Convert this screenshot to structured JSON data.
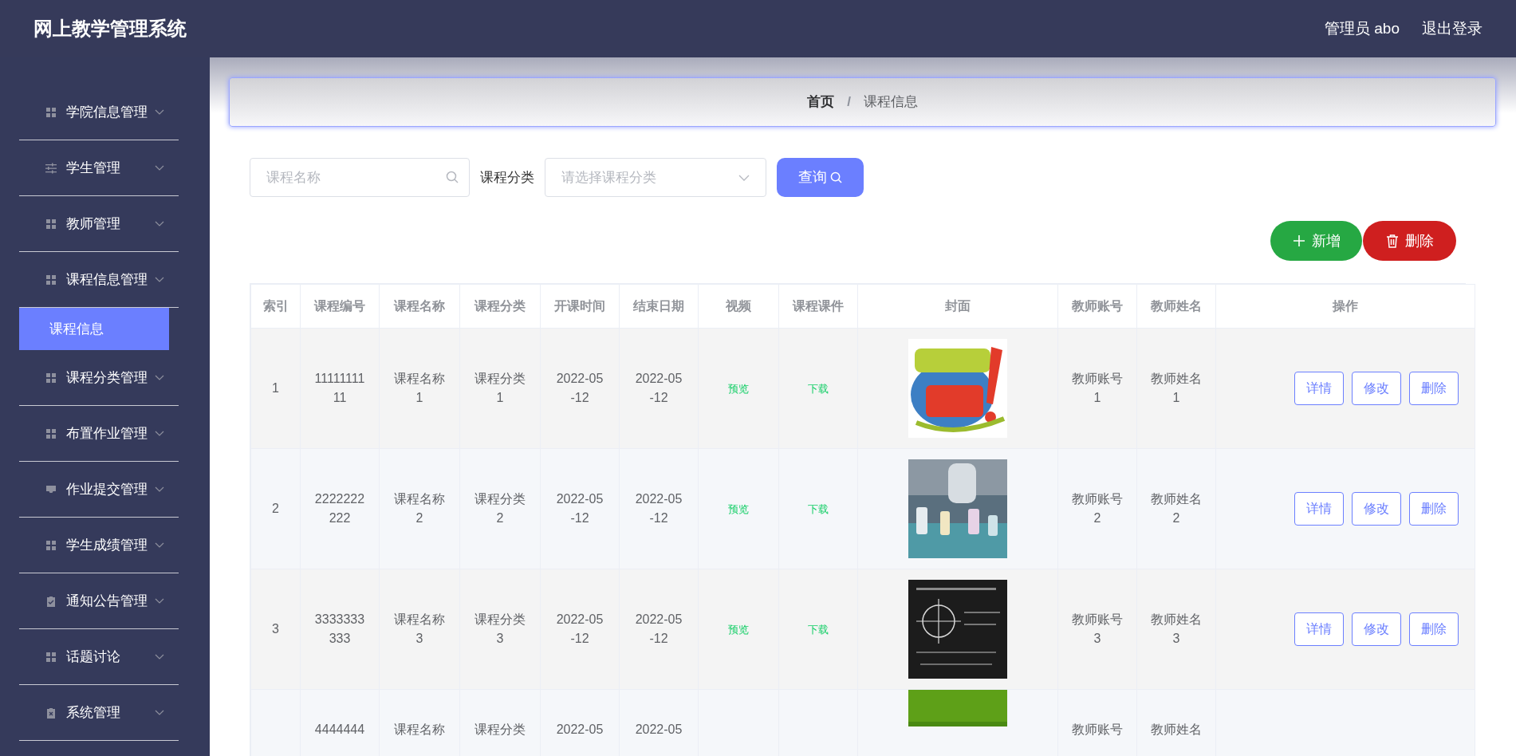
{
  "header": {
    "title": "网上教学管理系统",
    "user": "管理员 abo",
    "logout": "退出登录"
  },
  "sidebar": {
    "items": [
      {
        "label": "学院信息管理",
        "kind": "grid"
      },
      {
        "label": "学生管理",
        "kind": "sliders"
      },
      {
        "label": "教师管理",
        "kind": "grid"
      },
      {
        "label": "课程信息管理",
        "kind": "grid",
        "children": [
          {
            "label": "课程信息",
            "selected": true
          }
        ]
      },
      {
        "label": "课程分类管理",
        "kind": "grid"
      },
      {
        "label": "布置作业管理",
        "kind": "grid"
      },
      {
        "label": "作业提交管理",
        "kind": "tray"
      },
      {
        "label": "学生成绩管理",
        "kind": "grid"
      },
      {
        "label": "通知公告管理",
        "kind": "clipboard-check"
      },
      {
        "label": "话题讨论",
        "kind": "grid"
      },
      {
        "label": "系统管理",
        "kind": "clipboard-x"
      }
    ]
  },
  "breadcrumb": {
    "items": [
      "首页",
      "课程信息"
    ],
    "separator": "/"
  },
  "search": {
    "name_placeholder": "课程名称",
    "category_label": "课程分类",
    "category_placeholder": "请选择课程分类",
    "query_button": "查询"
  },
  "actions": {
    "add": "新增",
    "delete": "删除"
  },
  "table": {
    "columns": [
      "索引",
      "课程编号",
      "课程名称",
      "课程分类",
      "开课时间",
      "结束日期",
      "视频",
      "课程课件",
      "封面",
      "教师账号",
      "教师姓名",
      "操作"
    ],
    "rows": [
      {
        "cells": [
          "1",
          "1111111111",
          "课程名称1",
          "课程分类1",
          "2022-05-12",
          "2022-05-12"
        ],
        "video": "预览",
        "file": "下载",
        "cover": {
          "kind": "picture"
        },
        "teacher": [
          "教师账号1",
          "教师姓名1"
        ],
        "buttons": [
          "详情",
          "修改",
          "删除"
        ]
      },
      {
        "cells": [
          "2",
          "2222222222",
          "课程名称2",
          "课程分类2",
          "2022-05-12",
          "2022-05-12"
        ],
        "video": "预览",
        "file": "下载",
        "cover": {
          "kind": "picture"
        },
        "teacher": [
          "教师账号2",
          "教师姓名2"
        ],
        "buttons": [
          "详情",
          "修改",
          "删除"
        ]
      },
      {
        "cells": [
          "3",
          "3333333333",
          "课程名称3",
          "课程分类3",
          "2022-05-12",
          "2022-05-12"
        ],
        "video": "预览",
        "file": "下载",
        "cover": {
          "kind": "picture"
        },
        "teacher": [
          "教师账号3",
          "教师姓名3"
        ],
        "buttons": [
          "详情",
          "修改",
          "删除"
        ]
      },
      {
        "cells": [
          "",
          "4444444",
          "课程名称",
          "课程分类",
          "2022-05",
          "2022-05"
        ],
        "cover": {
          "kind": "picture"
        },
        "teacher": [
          "教师账号",
          "教师姓名"
        ]
      }
    ]
  }
}
